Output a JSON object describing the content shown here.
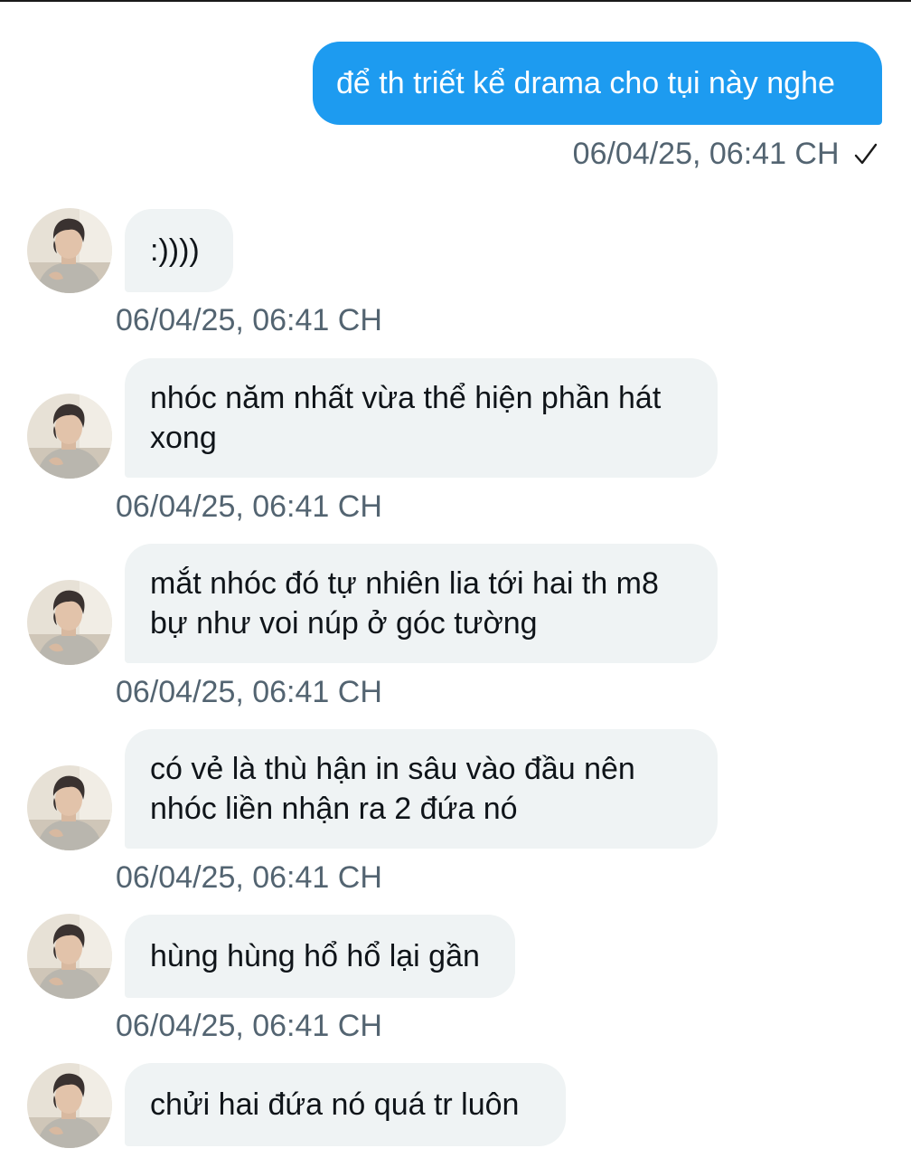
{
  "colors": {
    "outgoing_bubble": "#1d9bf0",
    "incoming_bubble": "#eff3f4",
    "timestamp": "#536471",
    "text": "#0f1419"
  },
  "outgoing": {
    "text": "để th triết kể drama cho tụi này nghe",
    "timestamp": "06/04/25, 06:41 CH",
    "status_icon": "check-icon"
  },
  "incoming": [
    {
      "text": ":))))",
      "timestamp": "06/04/25, 06:41 CH"
    },
    {
      "text": "nhóc năm nhất vừa thể hiện phần hát xong",
      "timestamp": "06/04/25, 06:41 CH"
    },
    {
      "text": "mắt nhóc đó tự nhiên lia tới hai th m8 bự như voi núp ở góc tường",
      "timestamp": "06/04/25, 06:41 CH"
    },
    {
      "text": "có vẻ là thù hận in sâu vào đầu nên nhóc liền nhận ra 2 đứa nó",
      "timestamp": "06/04/25, 06:41 CH"
    },
    {
      "text": "hùng hùng hổ hổ lại gần",
      "timestamp": "06/04/25, 06:41 CH"
    },
    {
      "text": "chửi hai đứa nó quá tr luôn",
      "timestamp": ""
    }
  ]
}
